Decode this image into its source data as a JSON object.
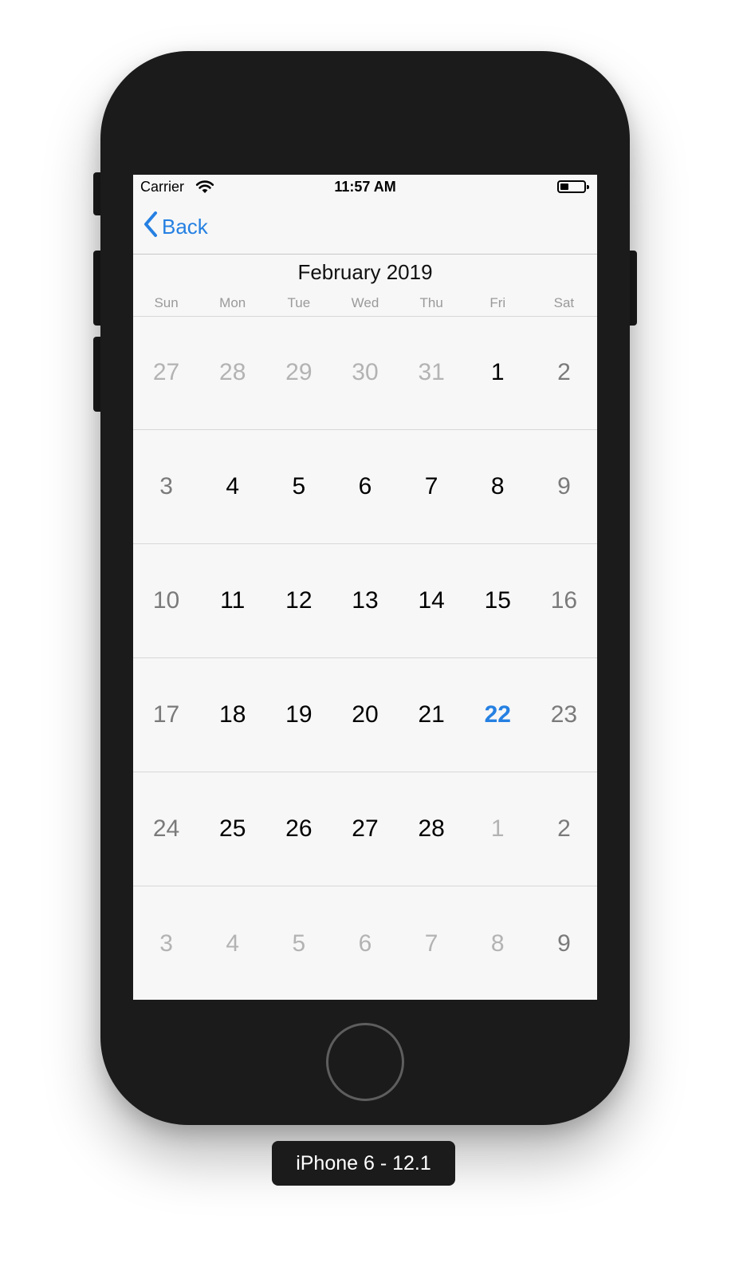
{
  "status_bar": {
    "carrier": "Carrier",
    "time": "11:57 AM",
    "battery_level": 0.35
  },
  "nav": {
    "back_label": "Back"
  },
  "calendar": {
    "month_title": "February 2019",
    "weekdays": [
      "Sun",
      "Mon",
      "Tue",
      "Wed",
      "Thu",
      "Fri",
      "Sat"
    ],
    "weeks": [
      [
        "27",
        "28",
        "29",
        "30",
        "31",
        "1",
        "2"
      ],
      [
        "3",
        "4",
        "5",
        "6",
        "7",
        "8",
        "9"
      ],
      [
        "10",
        "11",
        "12",
        "13",
        "14",
        "15",
        "16"
      ],
      [
        "17",
        "18",
        "19",
        "20",
        "21",
        "22",
        "23"
      ],
      [
        "24",
        "25",
        "26",
        "27",
        "28",
        "1",
        "2"
      ],
      [
        "3",
        "4",
        "5",
        "6",
        "7",
        "8",
        "9"
      ]
    ],
    "selected_day": "22",
    "today_color": "#2580e2"
  },
  "device_label": "iPhone 6 - 12.1",
  "colors": {
    "accent": "#2580e2",
    "device_body": "#1b1b1b",
    "screen_bg": "#f7f7f7"
  }
}
